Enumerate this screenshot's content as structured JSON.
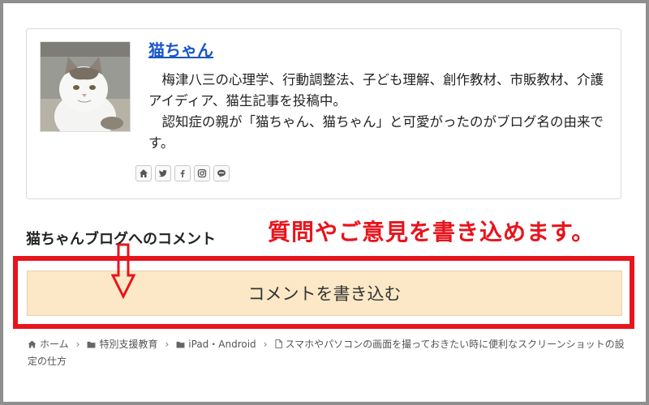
{
  "author": {
    "name": "猫ちゃん",
    "bio_1": "梅津八三の心理学、行動調整法、子ども理解、創作教材、市販教材、介護アイディア、猫生記事を投稿中。",
    "bio_2": "認知症の親が「猫ちゃん、猫ちゃん」と可愛がったのがブログ名の由来です。",
    "social_icons": [
      "home-icon",
      "twitter-icon",
      "facebook-icon",
      "instagram-icon",
      "line-icon"
    ]
  },
  "comments": {
    "heading": "猫ちゃんブログへのコメント",
    "annotation": "質問やご意見を書き込めます。",
    "button_label": "コメントを書き込む"
  },
  "breadcrumb": {
    "items": [
      {
        "icon": "home-icon",
        "label": "ホーム"
      },
      {
        "icon": "folder-icon",
        "label": "特別支援教育"
      },
      {
        "icon": "folder-icon",
        "label": "iPad・Android"
      },
      {
        "icon": "file-icon",
        "label": "スマホやパソコンの画面を撮っておきたい時に便利なスクリーンショットの設定の仕方"
      }
    ]
  },
  "colors": {
    "accent_red": "#e8141c",
    "link_blue": "#1a56c8",
    "button_bg": "#fce8c6"
  }
}
